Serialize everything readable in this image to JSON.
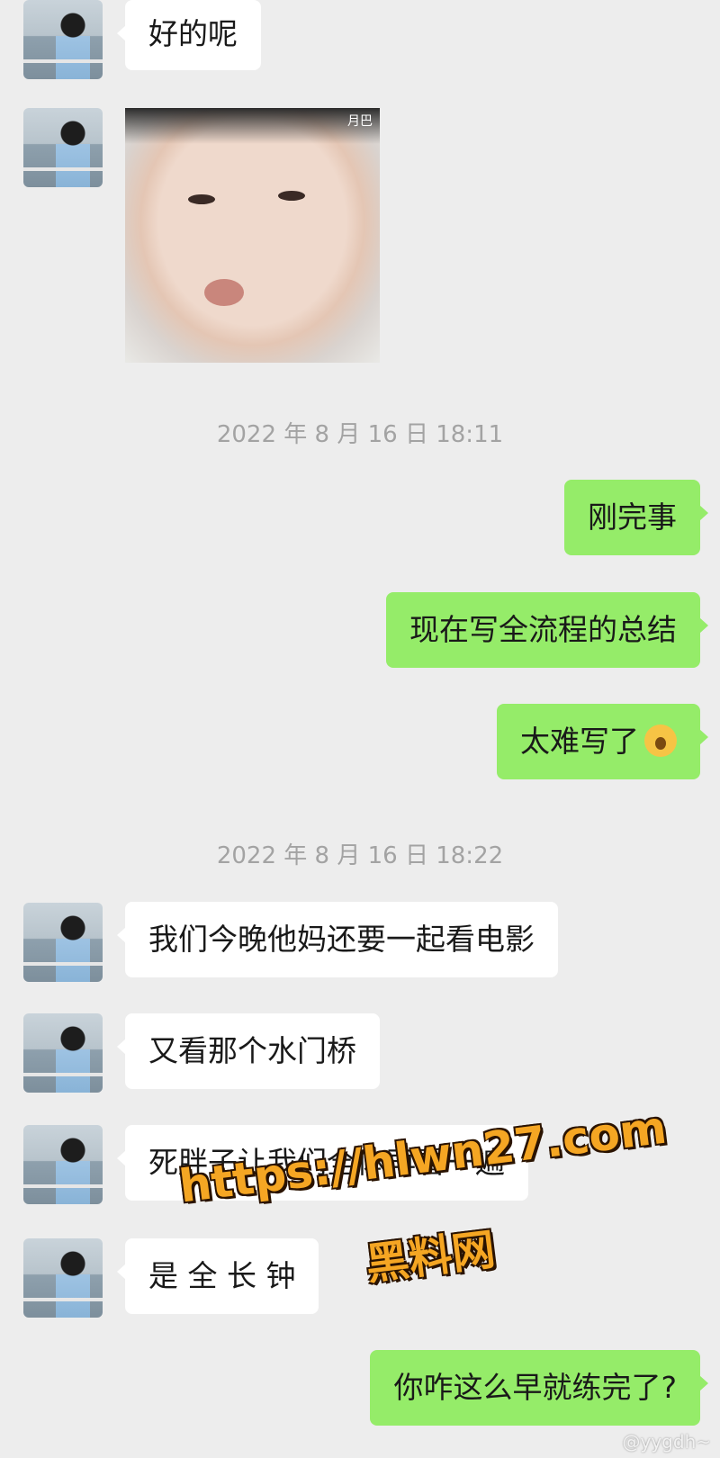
{
  "messages": [
    {
      "side": "left",
      "type": "text",
      "text": "好的呢"
    },
    {
      "side": "left",
      "type": "sticker",
      "sticker_label": "月巴"
    },
    {
      "type": "timestamp",
      "text": "2022 年 8 月 16 日  18:11"
    },
    {
      "side": "right",
      "type": "text",
      "text": "刚完事"
    },
    {
      "side": "right",
      "type": "text",
      "text": "现在写全流程的总结"
    },
    {
      "side": "right",
      "type": "text",
      "text": "太难写了",
      "emoji": "yawning-face-emoji"
    },
    {
      "type": "timestamp",
      "text": "2022 年 8 月 16 日  18:22"
    },
    {
      "side": "left",
      "type": "text",
      "text": "我们今晚他妈还要一起看电影"
    },
    {
      "side": "left",
      "type": "text",
      "text": "又看那个水门桥"
    },
    {
      "side": "left",
      "type": "text",
      "text": "死胖子让我们全体再看一遍"
    },
    {
      "side": "left",
      "type": "text",
      "text": "是 全 长 钟"
    },
    {
      "side": "right",
      "type": "text",
      "text": "你咋这么早就练完了?"
    }
  ],
  "watermark": {
    "url": "https://hlwn27.com",
    "name": "黑料网"
  },
  "weibo_handle": "@yygdh~",
  "colors": {
    "background": "#ededed",
    "left_bubble": "#ffffff",
    "right_bubble": "#95ec69",
    "timestamp": "#a3a3a3"
  }
}
